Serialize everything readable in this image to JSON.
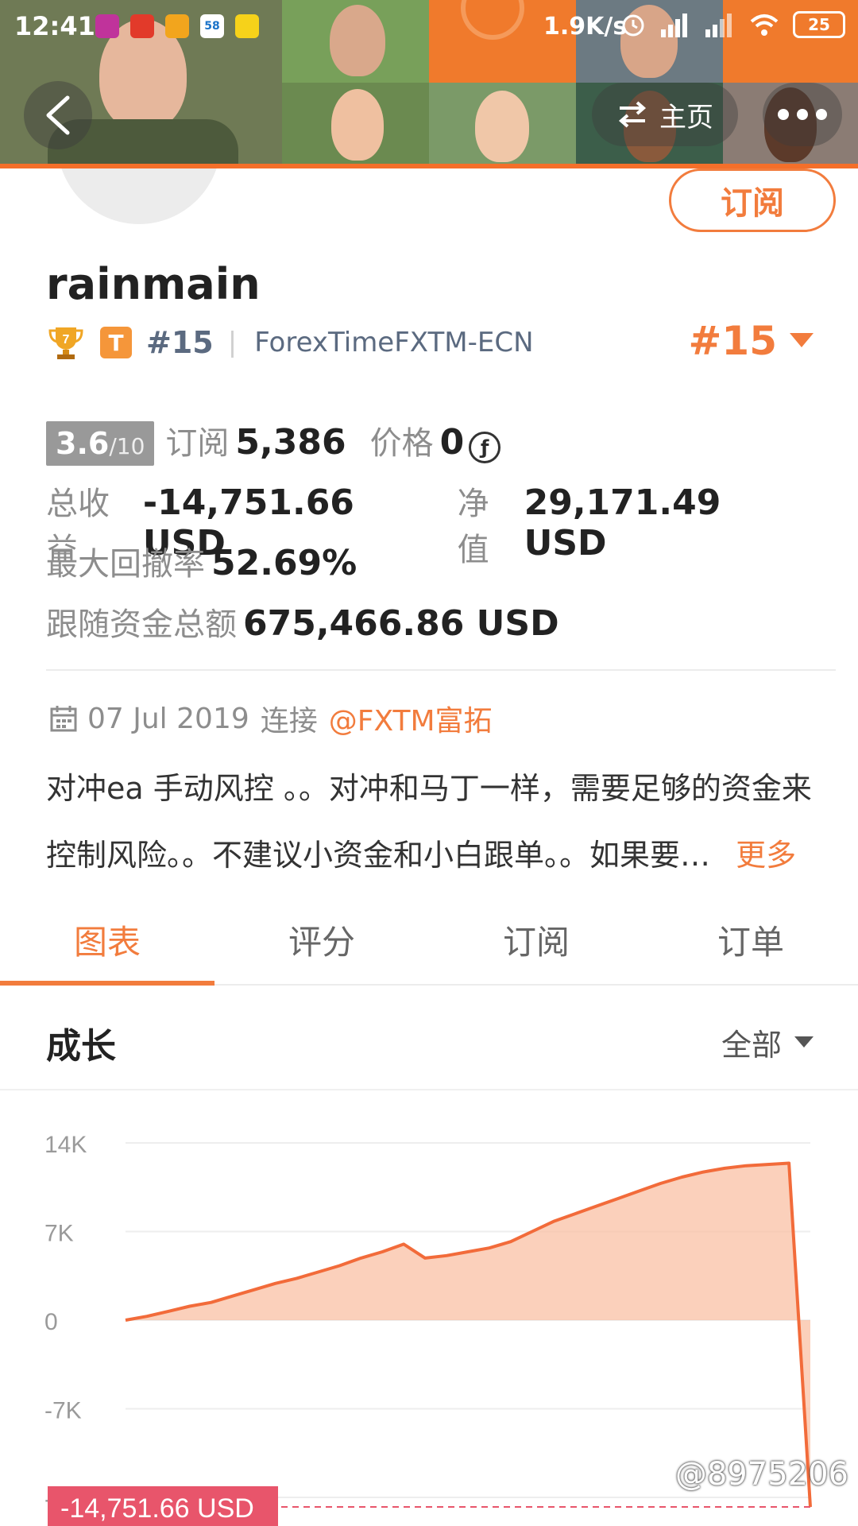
{
  "status_bar": {
    "time": "12:41",
    "net_speed": "1.9K/s",
    "battery": "25",
    "app_icons": [
      {
        "name": "app-icon-1",
        "color": "#c0339b",
        "text": ""
      },
      {
        "name": "app-icon-2",
        "color": "#e23a2a",
        "text": ""
      },
      {
        "name": "app-icon-3",
        "color": "#f2a51d",
        "text": ""
      },
      {
        "name": "app-icon-4",
        "color": "#ffffff",
        "text": "58"
      },
      {
        "name": "app-icon-5",
        "color": "#f6d21a",
        "text": ""
      }
    ]
  },
  "header": {
    "home_label": "主页"
  },
  "profile": {
    "subscribe_label": "订阅",
    "username": "rainmain",
    "rank_small": "#15",
    "broker": "ForexTimeFXTM-ECN",
    "rank_big": "#15",
    "trophy_digit": "7",
    "badge": "T"
  },
  "stats": {
    "score": "3.6",
    "score_max": "/10",
    "subscriptions_label": "订阅",
    "subscriptions": "5,386",
    "price_label": "价格",
    "price": "0",
    "price_symbol": "ƒ",
    "total_profit_label": "总收益",
    "total_profit": "-14,751.66 USD",
    "equity_label": "净值",
    "equity": "29,171.49 USD",
    "max_drawdown_label": "最大回撤率",
    "max_drawdown": "52.69%",
    "follow_funds_label": "跟随资金总额",
    "follow_funds": "675,466.86 USD"
  },
  "connection": {
    "date": "07 Jul 2019",
    "connect_label": "连接",
    "link": "@FXTM富拓"
  },
  "description": {
    "line1": "对冲ea 手动风控 。。对冲和马丁一样，需要足够的资金来",
    "line2": "控制风险。。不建议小资金和小白跟单。。如果要…",
    "more": "更多"
  },
  "tabs": [
    "图表",
    "评分",
    "订阅",
    "订单"
  ],
  "growth": {
    "title": "成长",
    "range": "全部"
  },
  "chart_data": {
    "type": "area",
    "y_ticks": [
      "14K",
      "7K",
      "0",
      "-7K",
      "-14K"
    ],
    "ylim": [
      -14000,
      14000
    ],
    "series": [
      {
        "values": [
          0,
          300,
          700,
          1100,
          1400,
          1900,
          2400,
          2900,
          3300,
          3800,
          4300,
          4900,
          5400,
          6000,
          4900,
          5100,
          5400,
          5700,
          6200,
          7000,
          7800,
          8400,
          9000,
          9600,
          10200,
          10800,
          11300,
          11700,
          12000,
          12200,
          12300,
          12400,
          -14751.66
        ]
      }
    ],
    "last_value_label": "-14,751.66 USD",
    "colors": {
      "line": "#f26b3a",
      "fill": "#f9c0a4"
    }
  },
  "watermark": "@8975206"
}
